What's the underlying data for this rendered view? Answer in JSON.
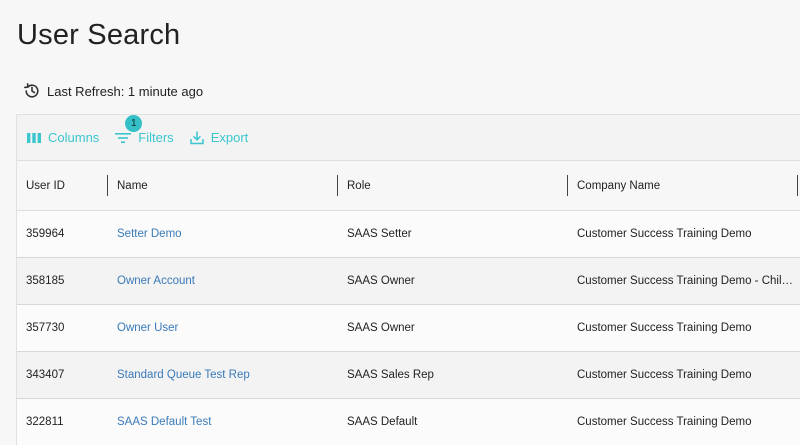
{
  "page": {
    "title": "User Search"
  },
  "refresh": {
    "icon": "history-icon",
    "label": "Last Refresh: 1 minute ago"
  },
  "toolbar": {
    "accent_color": "#3bc6cf",
    "columns_label": "Columns",
    "filters_label": "Filters",
    "filters_count": "1",
    "export_label": "Export"
  },
  "table": {
    "columns": [
      "User ID",
      "Name",
      "Role",
      "Company Name"
    ],
    "rows": [
      {
        "user_id": "359964",
        "name": "Setter Demo",
        "role": "SAAS Setter",
        "company": "Customer Success Training Demo"
      },
      {
        "user_id": "358185",
        "name": "Owner Account",
        "role": "SAAS Owner",
        "company": "Customer Success Training Demo - Child A..."
      },
      {
        "user_id": "357730",
        "name": "Owner User",
        "role": "SAAS Owner",
        "company": "Customer Success Training Demo"
      },
      {
        "user_id": "343407",
        "name": "Standard Queue Test Rep",
        "role": "SAAS Sales Rep",
        "company": "Customer Success Training Demo"
      },
      {
        "user_id": "322811",
        "name": "SAAS Default Test",
        "role": "SAAS Default",
        "company": "Customer Success Training Demo"
      }
    ]
  }
}
